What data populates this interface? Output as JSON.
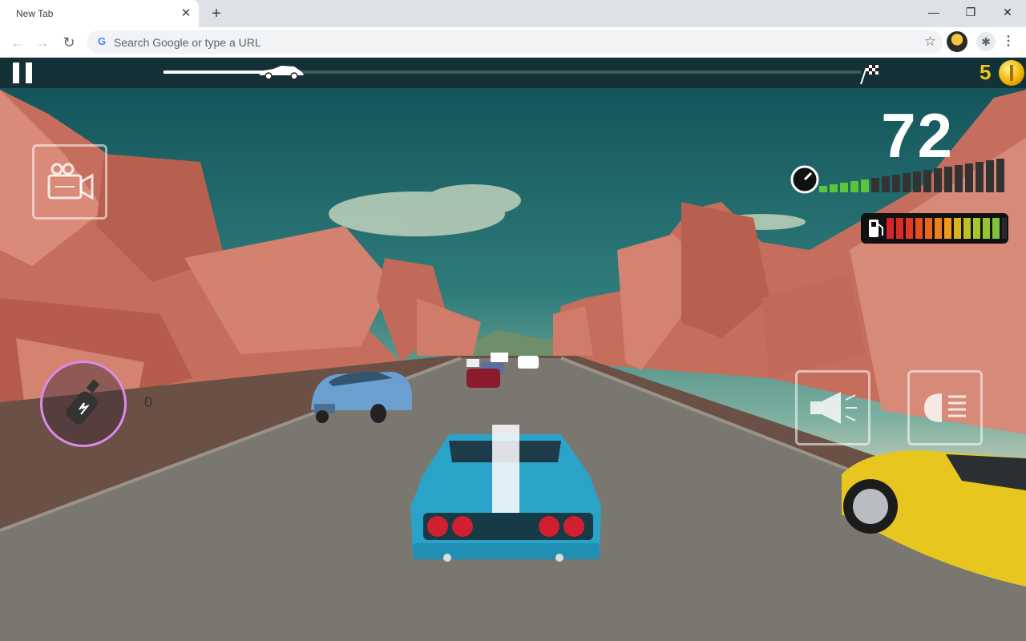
{
  "browser": {
    "tab_title": "New Tab",
    "tab_close": "✕",
    "new_tab": "+",
    "window_controls": {
      "minimize": "—",
      "restore": "❐",
      "close": "✕"
    },
    "nav": {
      "back": "←",
      "forward": "→",
      "reload": "↻"
    },
    "omnibox": {
      "g_icon": "G",
      "placeholder": "Search Google or type a URL",
      "star": "☆"
    },
    "extensions": "✱",
    "menu": "⋮"
  },
  "game": {
    "coins": "5",
    "speed": "72",
    "nitro_count": "0",
    "race_progress": 0.18,
    "rpm_level": 0.26,
    "fuel_level": 0.93,
    "icons": {
      "pause": "pause-icon",
      "progress_car": "car-icon",
      "finish": "checkered-flag-icon",
      "coin": "coin-icon",
      "camera": "camera-switch-icon",
      "nitro": "nitro-bottle-icon",
      "horn": "horn-icon",
      "headlights": "headlight-icon",
      "speedometer": "speedometer-icon",
      "fuel": "fuel-pump-icon"
    },
    "colors": {
      "coin": "#f2c318",
      "player_car": "#2ba3c9",
      "traffic_car": "#e8c620",
      "nitro_ring": "#d98be8"
    }
  }
}
